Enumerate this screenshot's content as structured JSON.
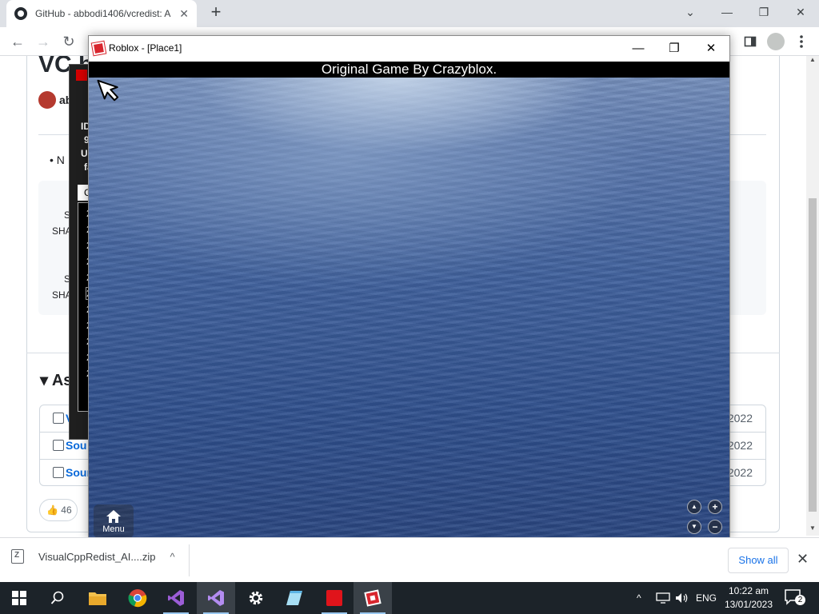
{
  "browser": {
    "tab_title": "GitHub - abbodi1406/vcredist: A",
    "tab_close": "✕",
    "new_tab": "+",
    "nav_back": "←",
    "nav_forward": "→",
    "nav_reload": "↻",
    "window_controls": {
      "tab_search": "⌄",
      "minimize": "—",
      "restore": "❐",
      "close": "✕"
    }
  },
  "page": {
    "title": "VC b",
    "author": "ab",
    "bullet": "N",
    "sha_lines": [
      {
        "s": "S",
        "sha": "SHA"
      },
      {
        "s": "S",
        "sha": "SHA"
      }
    ],
    "assets_heading": "As",
    "assets": [
      {
        "label": "V",
        "date": "2022",
        "icon": "package-icon"
      },
      {
        "label": "Sou",
        "date": "2022",
        "icon": "file-zip-icon"
      },
      {
        "label": "Sour",
        "date": "2022",
        "icon": "file-zip-icon"
      }
    ],
    "reactions_count": "46"
  },
  "dark_app": {
    "lines": [
      "ID",
      "9",
      "Us",
      "fa"
    ],
    "tab_header": "C",
    "list_items": [
      "2",
      "2",
      "2",
      "2",
      "2",
      "2",
      "2",
      "2",
      "2",
      "2",
      "2"
    ]
  },
  "roblox": {
    "window_title": "Roblox - [Place1]",
    "controls": {
      "minimize": "—",
      "restore": "❐",
      "close": "✕"
    },
    "banner": "Original Game By Crazyblox.",
    "menu_label": "Menu",
    "camera_controls": {
      "up": "▲",
      "zoom_in": "+",
      "down": "▼",
      "zoom_out": "−"
    }
  },
  "downloads": {
    "file_name": "VisualCppRedist_AI....zip",
    "chevron": "^",
    "show_all": "Show all",
    "close": "✕"
  },
  "taskbar": {
    "apps": [
      {
        "name": "start",
        "icon": "windows-icon"
      },
      {
        "name": "search",
        "icon": "search-icon"
      },
      {
        "name": "file-explorer",
        "icon": "folder-icon"
      },
      {
        "name": "chrome",
        "icon": "chrome-icon"
      },
      {
        "name": "visual-studio",
        "icon": "visual-studio-icon"
      },
      {
        "name": "vs-code",
        "icon": "vscode-icon"
      },
      {
        "name": "settings",
        "icon": "gear-icon"
      },
      {
        "name": "notepad",
        "icon": "notepad-icon"
      },
      {
        "name": "red-app",
        "icon": "red-square-icon"
      },
      {
        "name": "roblox",
        "icon": "roblox-icon"
      }
    ],
    "tray": {
      "chevron": "^",
      "lang": "ENG"
    },
    "time": "10:22 am",
    "date": "13/01/2023",
    "notifications": "2"
  }
}
